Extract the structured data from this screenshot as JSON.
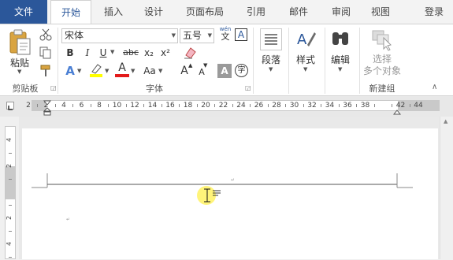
{
  "tabs": {
    "file": "文件",
    "home": "开始",
    "insert": "插入",
    "design": "设计",
    "layout": "页面布局",
    "references": "引用",
    "mailings": "邮件",
    "review": "审阅",
    "view": "视图",
    "login": "登录"
  },
  "clipboard": {
    "paste_label": "粘贴",
    "group_label": "剪贴板"
  },
  "font": {
    "font_name": "宋体",
    "font_size": "五号",
    "phonetic_top": "wén",
    "phonetic_char": "文",
    "border_char": "A",
    "bold": "B",
    "italic": "I",
    "underline": "U",
    "strikethrough": "abc",
    "subscript": "x₂",
    "superscript": "x²",
    "text_effects": "A",
    "font_color": "A",
    "change_case": "Aa",
    "grow_font": "A",
    "shrink_font": "A",
    "char_shading": "A",
    "enclose_char": "字",
    "group_label": "字体"
  },
  "paragraph": {
    "label": "段落"
  },
  "styles": {
    "label": "样式"
  },
  "editing": {
    "label": "编辑"
  },
  "new_group": {
    "select_objects": "选择\n多个对象",
    "select_line1": "选择",
    "select_line2": "多个对象",
    "group_label": "新建组"
  },
  "ruler": {
    "numbers": [
      "2",
      "2",
      "4",
      "6",
      "8",
      "10",
      "12",
      "14",
      "16",
      "18",
      "20",
      "22",
      "24",
      "26",
      "28",
      "30",
      "32",
      "34",
      "36",
      "38",
      "",
      "42",
      "44"
    ],
    "vertical_numbers": [
      "4",
      "2",
      "",
      "2",
      "4"
    ]
  },
  "colors": {
    "accent": "#2b579a",
    "highlight": "#ffff00",
    "font_color_red": "#e31b1b",
    "cursor_highlight": "#fff36b"
  }
}
